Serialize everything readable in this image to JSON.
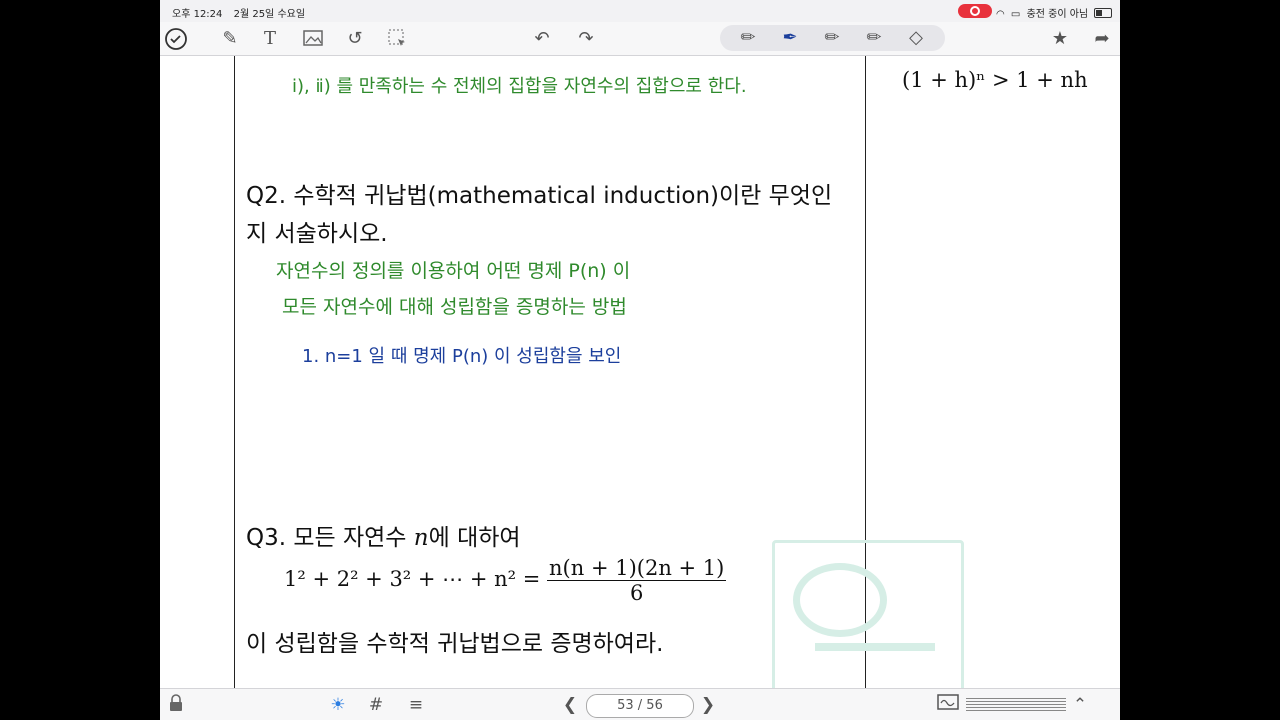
{
  "status": {
    "time": "오후 12:24",
    "date": "2월 25일 수요일",
    "charging": "충전 중이 아님"
  },
  "toolbar": {
    "icons": [
      "check-icon",
      "pen-icon",
      "text-icon",
      "image-icon",
      "lasso-icon",
      "select-icon",
      "undo-icon",
      "redo-icon",
      "pencil-icon",
      "fountain-pen-icon",
      "marker-icon",
      "highlighter-icon",
      "eraser-icon",
      "star-icon",
      "share-icon"
    ]
  },
  "page": {
    "line_top": "ⅰ), ⅱ) 를   만족하는   수   전체의  집합을     자연수의   집합으로  한다.",
    "q2_line1": "Q2. 수학적 귀납법(mathematical induction)이란 무엇인",
    "q2_line2": "지 서술하시오.",
    "ans1": "자연수의   정의를    이용하여     어떤  명제   P(n) 이",
    "ans2": "모든   자연수에   대해     성립함을    증명하는   방법",
    "ans3": "1.   n=1  일 때    명제   P(n) 이  성립함을  보인",
    "q3_line1_a": "Q3. 모든 자연수 ",
    "q3_var": "n",
    "q3_line1_b": "에 대하여",
    "formula_lhs": "1² + 2² + 3² +  ⋯  + n² =",
    "formula_num": "n(n + 1)(2n + 1)",
    "formula_den": "6",
    "q3_line3": "이 성립함을 수학적 귀납법으로 증명하여라.",
    "side_formula": "(1 + h)ⁿ > 1 + nh"
  },
  "bottom": {
    "page_indicator": "53 / 56"
  },
  "colors": {
    "green_ink": "#2f8a2c",
    "blue_ink": "#1c3f9c",
    "record": "#e8323c"
  }
}
